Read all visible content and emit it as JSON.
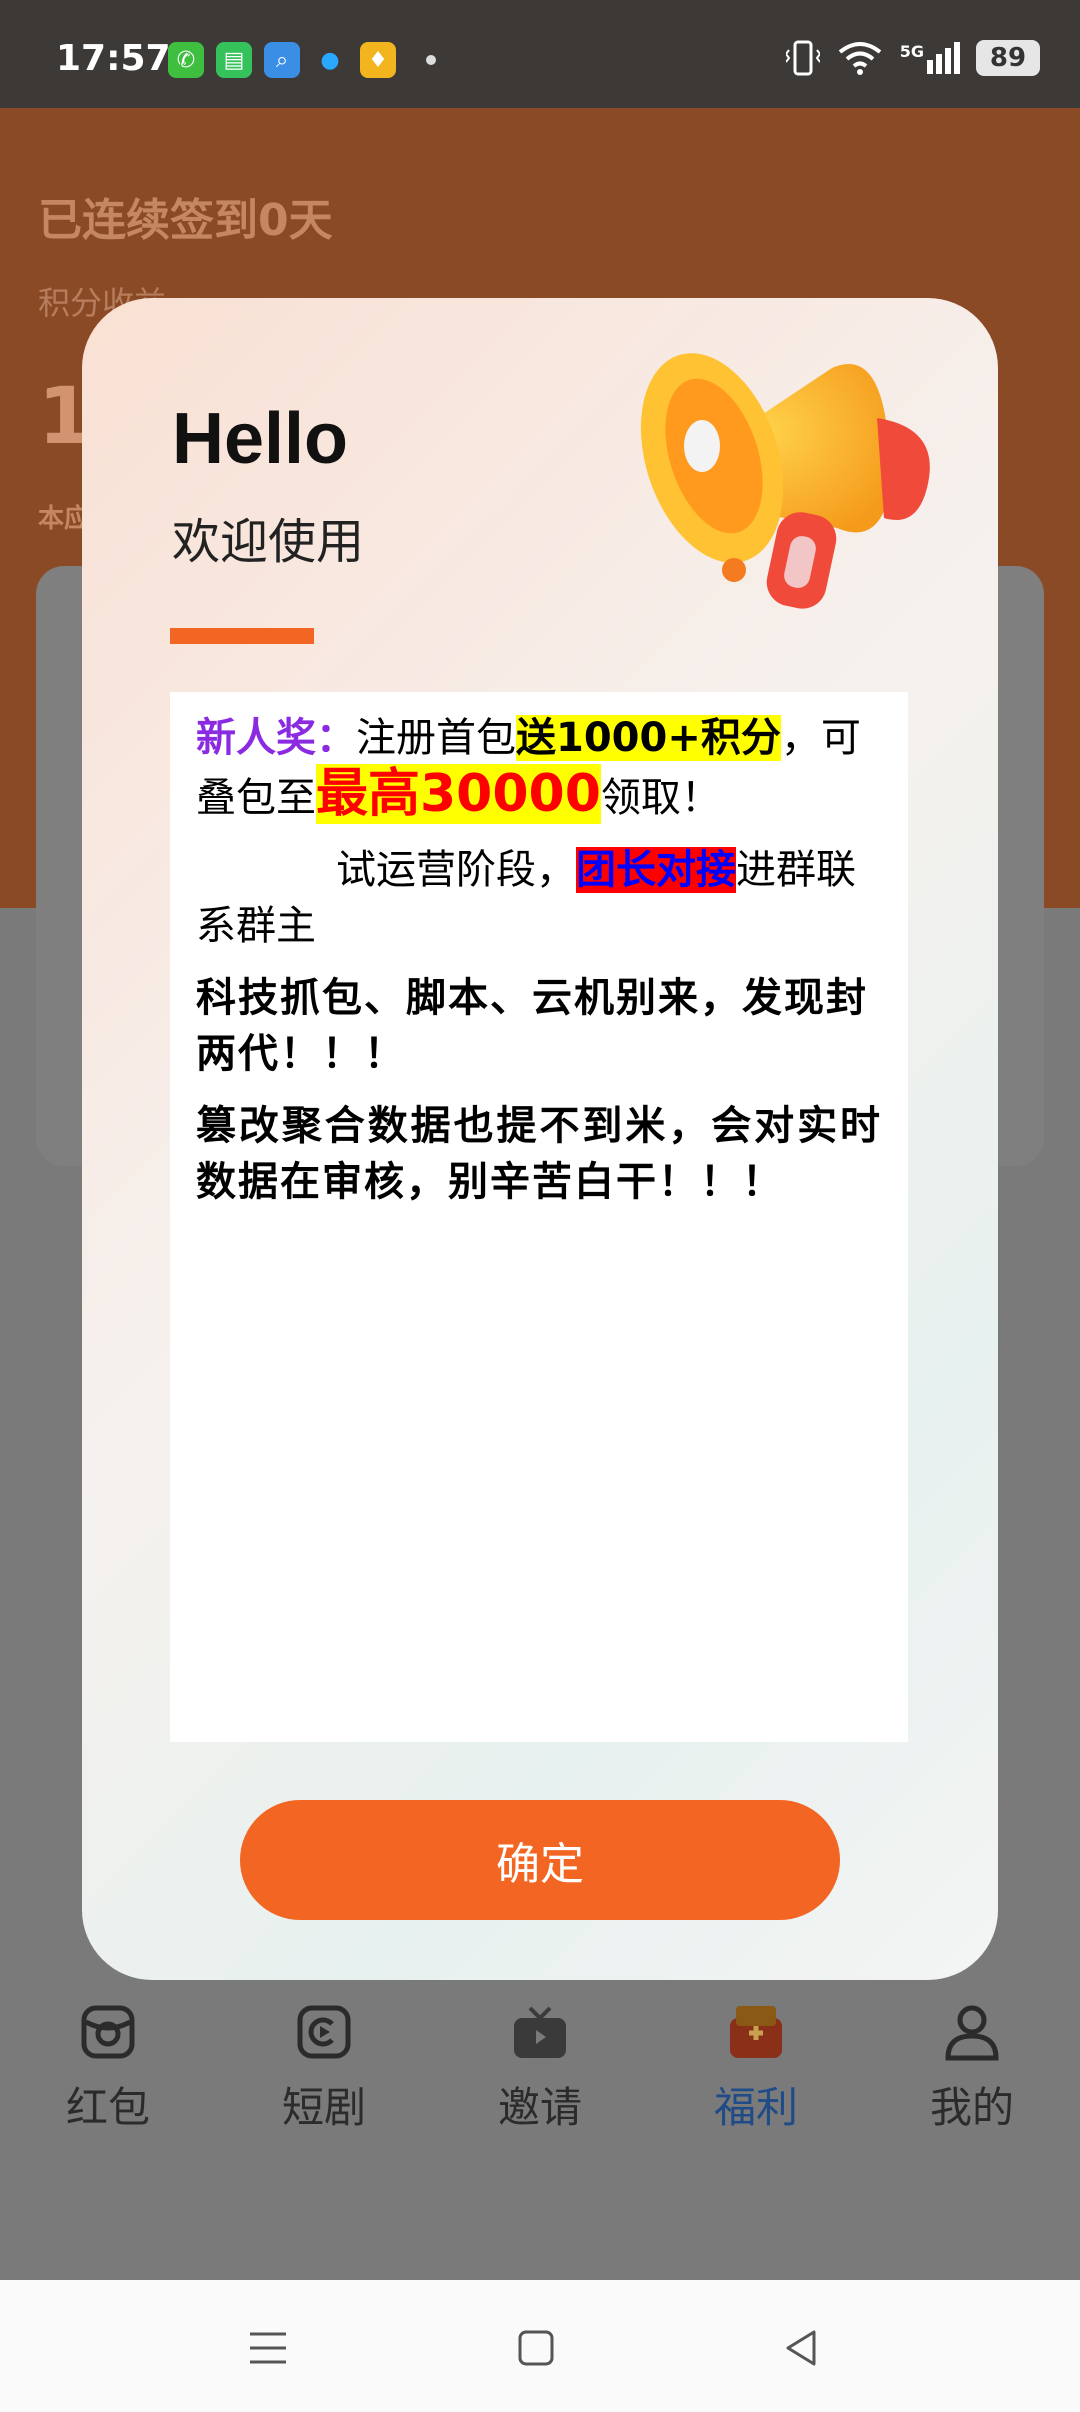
{
  "status_bar": {
    "time": "17:57",
    "network": "5G",
    "battery": "89",
    "app_icons": [
      "phone-app-icon",
      "messages-app-icon",
      "search-app-icon",
      "qq-app-icon",
      "wallet-app-icon"
    ]
  },
  "background": {
    "checkin_title": "已连续签到0天",
    "points_label": "积分收益",
    "points_value": "1",
    "today_label": "本应"
  },
  "tabs": [
    {
      "label": "红包",
      "icon": "redpacket-icon"
    },
    {
      "label": "短剧",
      "icon": "video-icon"
    },
    {
      "label": "邀请",
      "icon": "tv-icon"
    },
    {
      "label": "福利",
      "icon": "gift-icon"
    },
    {
      "label": "我的",
      "icon": "profile-icon"
    }
  ],
  "active_tab": "福利",
  "dialog": {
    "title": "Hello",
    "subtitle": "欢迎使用",
    "p1": {
      "label": "新人奖：",
      "text1": "注册首包",
      "highlight1": "送1000+积分",
      "text2": "，可叠包至",
      "highlight2": "最高30000",
      "text3": "领取！"
    },
    "p2": {
      "text1": "试运营阶段，",
      "highlight": "团长对接",
      "text2": "进群联系群主"
    },
    "p3": "科技抓包、脚本、云机别来，发现封两代！！！",
    "p4": "篡改聚合数据也提不到米，会对实时数据在审核，别辛苦白干！！！",
    "confirm_label": "确定"
  },
  "colors": {
    "accent": "#f26522",
    "active_tab": "#1f4b86"
  }
}
